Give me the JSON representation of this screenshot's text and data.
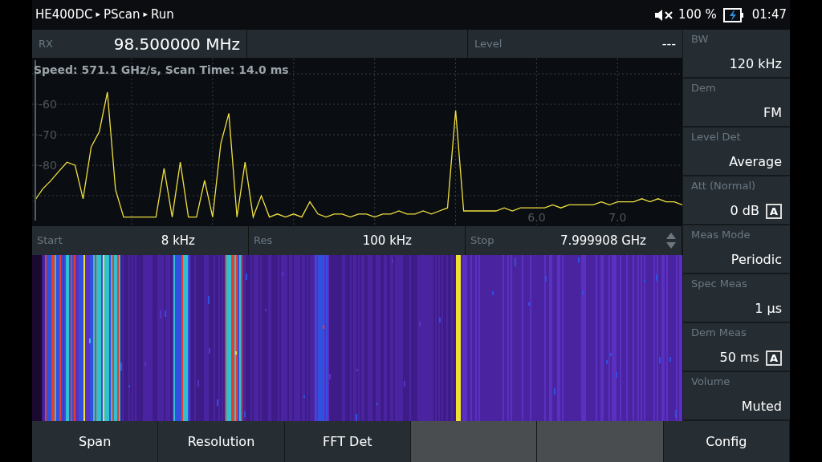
{
  "status_bar": {
    "breadcrumb": [
      "HE400DC",
      "PScan",
      "Run"
    ],
    "separator": "▸",
    "muted": true,
    "battery": "100 %",
    "time": "01:47"
  },
  "receiver": {
    "rx_label": "RX",
    "rx_value": "98.500000 MHz",
    "level_label": "Level",
    "level_value": "---"
  },
  "spectrum": {
    "info": "Speed: 571.1 GHz/s, Scan Time: 14.0 ms",
    "chart_data": {
      "type": "line",
      "grid": true,
      "xlim": [
        -0.23,
        7.8
      ],
      "ylim": [
        -100,
        -45
      ],
      "xticks": [
        {
          "value": 6,
          "label": "6.0"
        },
        {
          "value": 7,
          "label": "7.0"
        }
      ],
      "yticks": [
        -60,
        -70,
        -80
      ],
      "x": [
        -0.2,
        -0.1,
        0,
        0.1,
        0.2,
        0.3,
        0.4,
        0.5,
        0.6,
        0.7,
        0.8,
        0.9,
        1,
        1.1,
        1.2,
        1.3,
        1.4,
        1.5,
        1.6,
        1.7,
        1.8,
        1.9,
        2,
        2.1,
        2.2,
        2.3,
        2.4,
        2.5,
        2.6,
        2.7,
        2.8,
        2.9,
        3,
        3.1,
        3.2,
        3.3,
        3.4,
        3.5,
        3.6,
        3.7,
        3.8,
        3.9,
        4,
        4.1,
        4.2,
        4.3,
        4.4,
        4.5,
        4.6,
        4.7,
        4.8,
        4.9,
        5,
        5.1,
        5.2,
        5.3,
        5.4,
        5.5,
        5.6,
        5.7,
        5.8,
        5.9,
        6,
        6.1,
        6.2,
        6.3,
        6.4,
        6.5,
        6.6,
        6.7,
        6.8,
        6.9,
        7,
        7.1,
        7.2,
        7.3,
        7.4,
        7.5,
        7.6,
        7.7,
        7.8
      ],
      "series": [
        {
          "color": "#f0e040",
          "values": [
            -91.7,
            -87.8,
            -85.1,
            -82,
            -79,
            -80,
            -91,
            -74,
            -69,
            -56,
            -88,
            -97,
            -97,
            -97,
            -97,
            -97,
            -81,
            -97,
            -79,
            -97,
            -97,
            -85,
            -97,
            -73,
            -63,
            -97,
            -79,
            -97,
            -90,
            -97,
            -96,
            -97,
            -96,
            -97,
            -92,
            -96,
            -97,
            -96,
            -96,
            -97,
            -96,
            -96,
            -97,
            -96,
            -96,
            -95,
            -96,
            -96,
            -95,
            -96,
            -95,
            -94,
            -62,
            -95,
            -95,
            -95,
            -95,
            -95,
            -94,
            -95,
            -94,
            -94,
            -94,
            -94,
            -93,
            -94,
            -93,
            -93,
            -93,
            -93,
            -92,
            -93,
            -92,
            -92,
            -92,
            -91,
            -92,
            -91,
            -92,
            -92,
            -93
          ]
        }
      ]
    }
  },
  "span": [
    {
      "label": "Start",
      "value": "8 kHz"
    },
    {
      "label": "Res",
      "value": "100 kHz"
    },
    {
      "label": "Stop",
      "value": "7.999908 GHz",
      "spinner": true
    }
  ],
  "parameters": [
    {
      "label": "BW",
      "value": "120 kHz"
    },
    {
      "label": "Dem",
      "value": "FM"
    },
    {
      "label": "Level Det",
      "value": "Average"
    },
    {
      "label": "Att (Normal)",
      "value": "0 dB",
      "badge": "A"
    },
    {
      "label": "Meas Mode",
      "value": "Periodic"
    },
    {
      "label": "Spec Meas",
      "value": "1 µs"
    },
    {
      "label": "Dem Meas",
      "value": "50 ms",
      "badge": "A"
    },
    {
      "label": "Volume",
      "value": "Muted"
    }
  ],
  "softkeys": [
    {
      "kind": "labeled",
      "label": "Span"
    },
    {
      "kind": "labeled",
      "label": "Resolution"
    },
    {
      "kind": "labeled",
      "label": "FFT Det"
    },
    {
      "kind": "blank"
    },
    {
      "kind": "blank"
    },
    {
      "kind": "labeled",
      "label": "Config"
    }
  ]
}
